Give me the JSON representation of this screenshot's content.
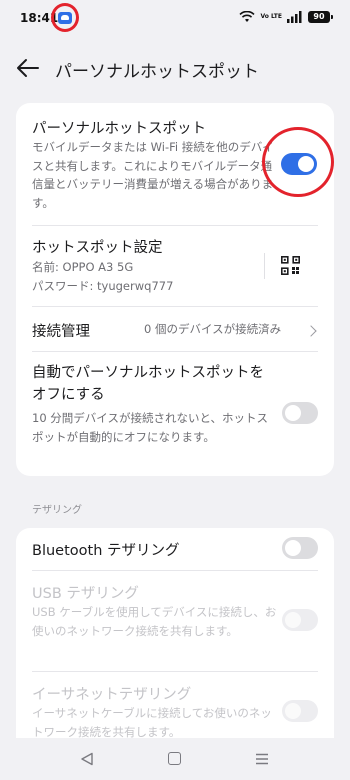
{
  "status_bar": {
    "time": "18:41",
    "network_label": "Vo LTE",
    "battery": "90"
  },
  "header": {
    "title": "パーソナルホットスポット",
    "back_icon": "arrow-left-icon"
  },
  "hotspot": {
    "title": "パーソナルホットスポット",
    "description": "モバイルデータまたは Wi-Fi 接続を他のデバイスと共有します。これによりモバイルデータ通信量とバッテリー消費量が増える場合があります。",
    "enabled": true
  },
  "settings": {
    "title": "ホットスポット設定",
    "name": "名前: OPPO A3 5G",
    "password": "パスワード: tyugerwq777",
    "qr_icon": "qr-code-icon"
  },
  "connection": {
    "label": "接続管理",
    "value": "0 個のデバイスが接続済み"
  },
  "auto_off": {
    "title": "自動でパーソナルホットスポットをオフにする",
    "description": "10 分間デバイスが接続されないと、ホットスポットが自動的にオフになります。",
    "enabled": false
  },
  "tethering": {
    "section_label": "テザリング",
    "bluetooth": {
      "title": "Bluetooth テザリング",
      "enabled": false
    },
    "usb": {
      "title": "USB テザリング",
      "description": "USB ケーブルを使用してデバイスに接続し、お使いのネットワーク接続を共有します。",
      "enabled": false
    },
    "ethernet": {
      "title": "イーサネットテザリング",
      "description": "イーサネットケーブルに接続してお使いのネットワーク接続を共有します。",
      "enabled": false
    }
  },
  "colors": {
    "accent": "#2f6fe6",
    "annotation": "#e3232c"
  }
}
